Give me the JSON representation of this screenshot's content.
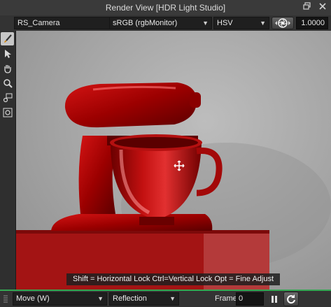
{
  "window": {
    "title": "Render View [HDR Light Studio]",
    "icons": {
      "restore": "restore-window-icon",
      "close": "close-window-icon"
    }
  },
  "toolbar": {
    "camera": {
      "value": "RS_Camera"
    },
    "color_space": {
      "value": "sRGB (rgbMonitor)"
    },
    "color_mode": {
      "value": "HSV"
    },
    "exposure_icon": "camera-aperture-icon",
    "exposure_value": "1.0000"
  },
  "tools": [
    {
      "name": "paint-brush-icon",
      "active": true
    },
    {
      "name": "select-arrow-icon",
      "active": false
    },
    {
      "name": "pan-hand-icon",
      "active": false
    },
    {
      "name": "zoom-icon",
      "active": false
    },
    {
      "name": "zoom-region-icon",
      "active": false
    },
    {
      "name": "fit-view-icon",
      "active": false
    }
  ],
  "viewport": {
    "subject": "red-stand-mixer-render",
    "cursor_icon": "move-cursor-icon",
    "hint": "Shift = Horizontal Lock   Ctrl=Vertical Lock   Opt = Fine Adjust"
  },
  "bottombar": {
    "mode": {
      "value": "Move (W)"
    },
    "light_mode": {
      "value": "Reflection"
    },
    "frame_label": "Frame",
    "frame_value": "0",
    "pause_icon": "pause-icon",
    "refresh_icon": "refresh-icon"
  },
  "colors": {
    "accent": "#34a853",
    "subject_red": "#b00000",
    "background_gray": "#a8a8a8"
  }
}
